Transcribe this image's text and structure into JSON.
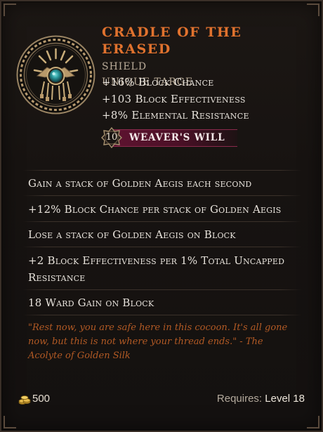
{
  "item": {
    "name": "Cradle of the Erased",
    "type": "Shield",
    "rarity": "Unique Targe",
    "icon": "woven-sun-targe-icon"
  },
  "implicits": [
    "+16% Block Chance",
    "+103 Block Effectiveness",
    "+8% Elemental Resistance"
  ],
  "set_bonus": {
    "level": "10",
    "label": "Weaver's Will",
    "color": "#5e1330"
  },
  "affixes": [
    "Gain a stack of Golden Aegis each second",
    "+12% Block Chance per stack of Golden Aegis",
    "Lose a stack of Golden Aegis on Block",
    "+2 Block Effectiveness per 1% Total Uncapped Resistance",
    "18 Ward Gain on Block"
  ],
  "lore": "\"Rest now, you are safe here in this cocoon. It's all gone now, but this is not where your thread ends.\" - The Acolyte of Golden Silk",
  "footer": {
    "gold_icon": "gold-coins-icon",
    "gold": "500",
    "requires_label": "Requires: ",
    "requires_value": "Level 18"
  },
  "colors": {
    "name": "#e0722e",
    "lore": "#b25a24",
    "text": "#e8e3dc",
    "subtext": "#b9ab98"
  }
}
